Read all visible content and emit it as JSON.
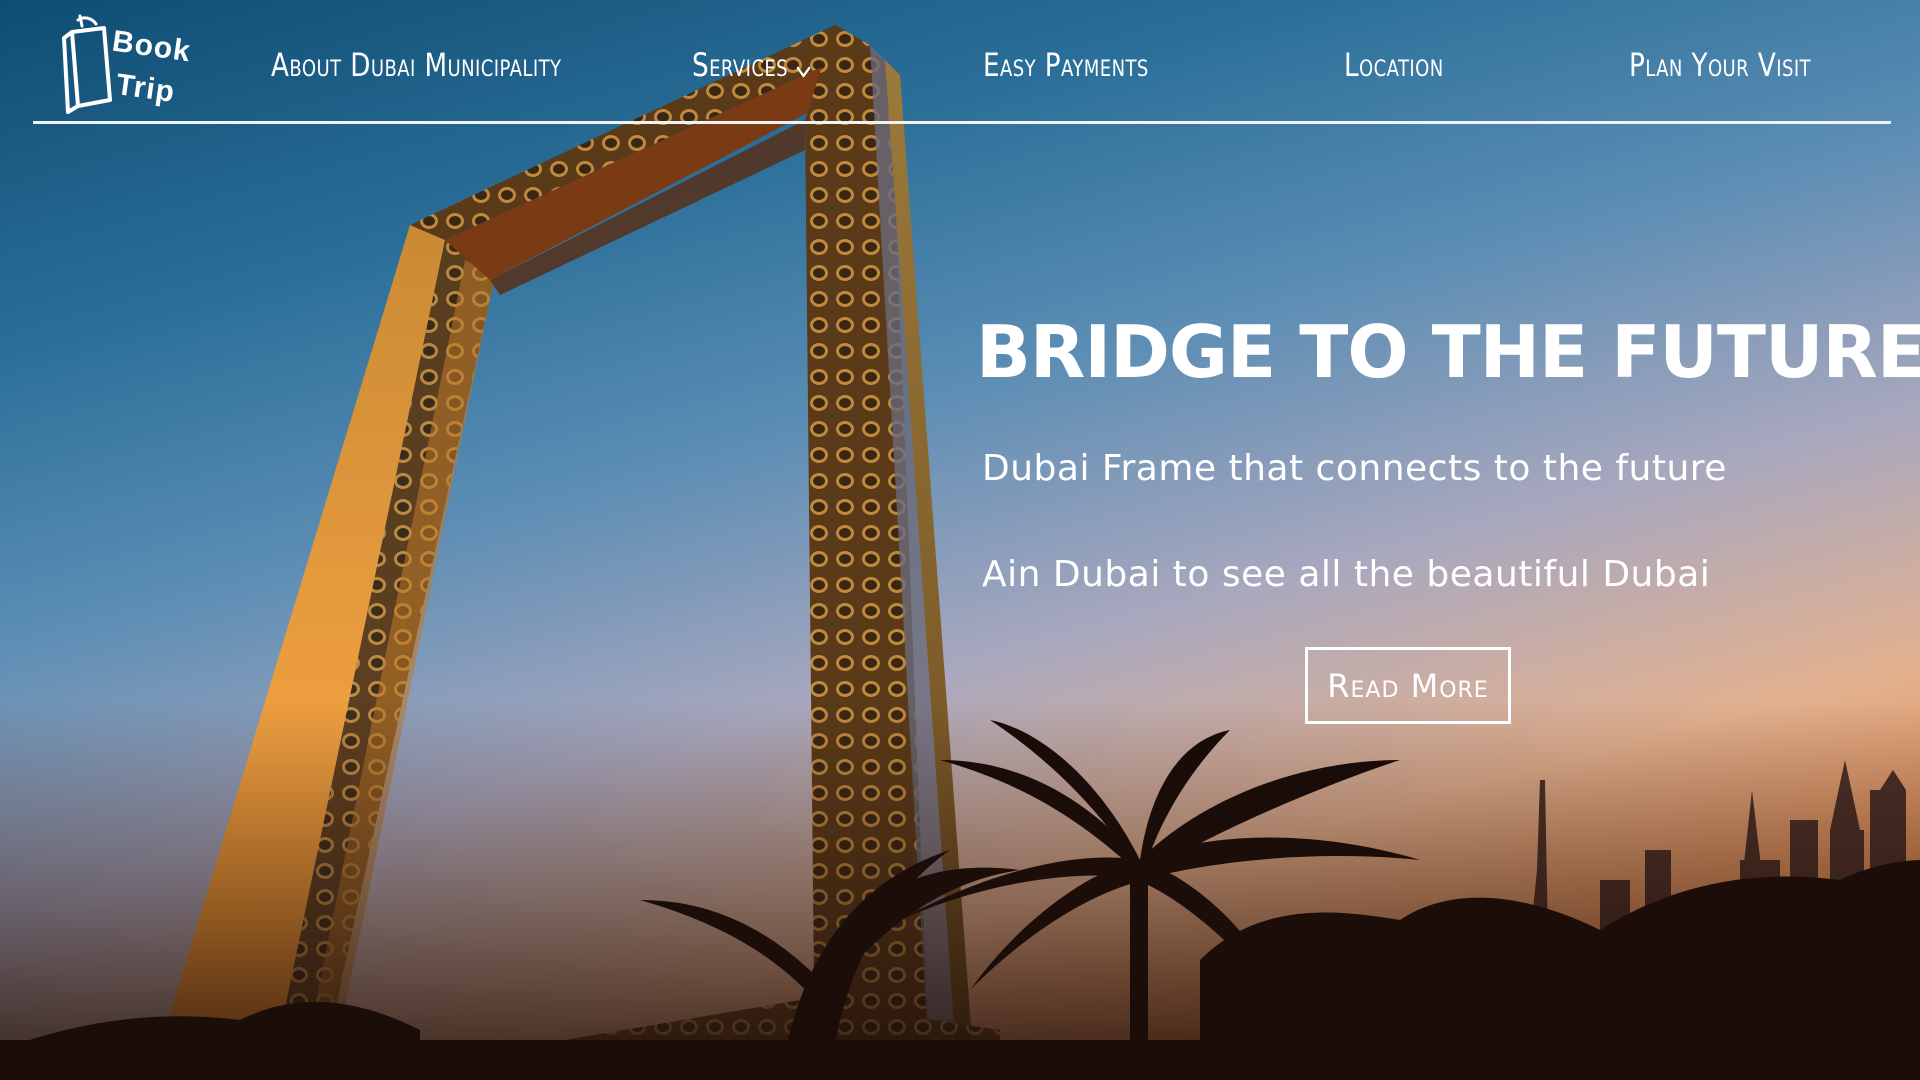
{
  "brand": {
    "logo_line1": "Book",
    "logo_line2": "Trip",
    "logo_icon": "book-icon"
  },
  "nav": {
    "items": [
      {
        "label": "About Dubai Municipality"
      },
      {
        "label": "Services",
        "icon": "chevron-down-icon"
      },
      {
        "label": "Easy Payments"
      },
      {
        "label": "Location"
      },
      {
        "label": "Plan Your Visit"
      }
    ]
  },
  "hero": {
    "headline": "BRIDGE TO THE FUTURE",
    "line1": "Dubai Frame that connects to the future",
    "line2": "Ain Dubai to see all the beautiful Dubai",
    "cta_label": "Read More"
  },
  "colors": {
    "text": "#ffffff",
    "sky_top": "#0f4c73",
    "sky_bottom": "#e28f55",
    "frame_gold": "#d99a3a"
  }
}
